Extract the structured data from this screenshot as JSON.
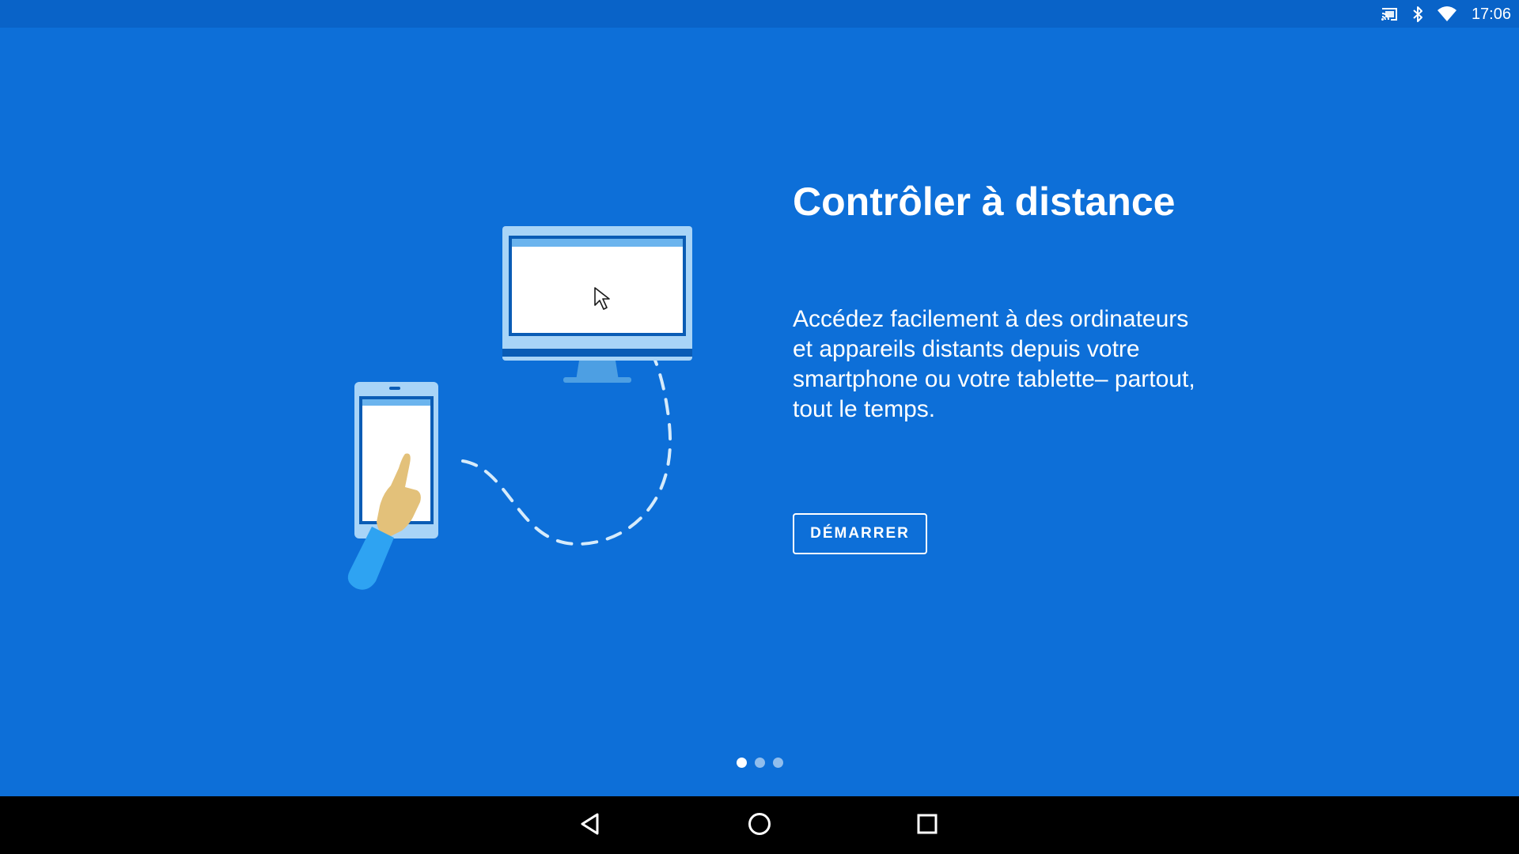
{
  "status_bar": {
    "time": "17:06",
    "icons": [
      "cast-icon",
      "bluetooth-icon",
      "wifi-icon"
    ]
  },
  "onboarding": {
    "title": "Contrôler à distance",
    "description": "Accédez facilement à des ordinateurs et appareils distants depuis votre smartphone ou votre tablette– partout, tout le temps.",
    "start_button_label": "DÉMARRER",
    "page_count": 3,
    "current_page": 1
  },
  "navigation_bar": {
    "buttons": [
      "back-icon",
      "home-icon",
      "recents-icon"
    ]
  },
  "colors": {
    "background": "#0d6fd8",
    "status_bar": "#0963c8",
    "accent_light": "#a8d4f7",
    "hand": "#e3c17a",
    "sleeve": "#2ea3f2"
  }
}
